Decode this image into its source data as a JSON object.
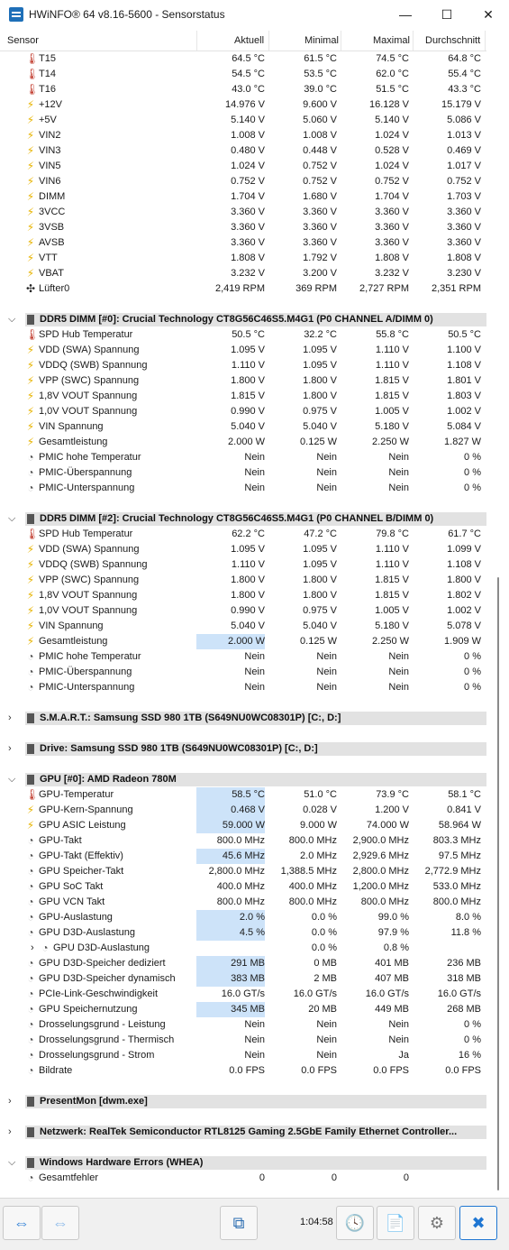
{
  "window": {
    "title": "HWiNFO® 64 v8.16-5600 - Sensorstatus",
    "min": "—",
    "max": "☐",
    "close": "✕"
  },
  "columns": {
    "sensor": "Sensor",
    "current": "Aktuell",
    "min": "Minimal",
    "max": "Maximal",
    "avg": "Durchschnitt"
  },
  "sections": [
    {
      "type": "rows",
      "rows": [
        {
          "icon": "thermometer",
          "label": "T15",
          "v": [
            "64.5 °C",
            "61.5 °C",
            "74.5 °C",
            "64.8 °C"
          ]
        },
        {
          "icon": "thermometer",
          "label": "T14",
          "v": [
            "54.5 °C",
            "53.5 °C",
            "62.0 °C",
            "55.4 °C"
          ]
        },
        {
          "icon": "thermometer",
          "label": "T16",
          "v": [
            "43.0 °C",
            "39.0 °C",
            "51.5 °C",
            "43.3 °C"
          ]
        },
        {
          "icon": "voltage",
          "label": "+12V",
          "v": [
            "14.976 V",
            "9.600 V",
            "16.128 V",
            "15.179 V"
          ]
        },
        {
          "icon": "voltage",
          "label": "+5V",
          "v": [
            "5.140 V",
            "5.060 V",
            "5.140 V",
            "5.086 V"
          ]
        },
        {
          "icon": "voltage",
          "label": "VIN2",
          "v": [
            "1.008 V",
            "1.008 V",
            "1.024 V",
            "1.013 V"
          ]
        },
        {
          "icon": "voltage",
          "label": "VIN3",
          "v": [
            "0.480 V",
            "0.448 V",
            "0.528 V",
            "0.469 V"
          ]
        },
        {
          "icon": "voltage",
          "label": "VIN5",
          "v": [
            "1.024 V",
            "0.752 V",
            "1.024 V",
            "1.017 V"
          ]
        },
        {
          "icon": "voltage",
          "label": "VIN6",
          "v": [
            "0.752 V",
            "0.752 V",
            "0.752 V",
            "0.752 V"
          ]
        },
        {
          "icon": "voltage",
          "label": "DIMM",
          "v": [
            "1.704 V",
            "1.680 V",
            "1.704 V",
            "1.703 V"
          ]
        },
        {
          "icon": "voltage",
          "label": "3VCC",
          "v": [
            "3.360 V",
            "3.360 V",
            "3.360 V",
            "3.360 V"
          ]
        },
        {
          "icon": "voltage",
          "label": "3VSB",
          "v": [
            "3.360 V",
            "3.360 V",
            "3.360 V",
            "3.360 V"
          ]
        },
        {
          "icon": "voltage",
          "label": "AVSB",
          "v": [
            "3.360 V",
            "3.360 V",
            "3.360 V",
            "3.360 V"
          ]
        },
        {
          "icon": "voltage",
          "label": "VTT",
          "v": [
            "1.808 V",
            "1.792 V",
            "1.808 V",
            "1.808 V"
          ]
        },
        {
          "icon": "voltage",
          "label": "VBAT",
          "v": [
            "3.232 V",
            "3.200 V",
            "3.232 V",
            "3.230 V"
          ]
        },
        {
          "icon": "fan",
          "label": "Lüfter0",
          "v": [
            "2,419 RPM",
            "369 RPM",
            "2,727 RPM",
            "2,351 RPM"
          ]
        }
      ]
    },
    {
      "type": "group",
      "expanded": true,
      "label": "DDR5 DIMM [#0]: Crucial Technology CT8G56C46S5.M4G1 (P0 CHANNEL A/DIMM 0)",
      "rows": [
        {
          "icon": "thermometer",
          "label": "SPD Hub Temperatur",
          "v": [
            "50.5 °C",
            "32.2 °C",
            "55.8 °C",
            "50.5 °C"
          ]
        },
        {
          "icon": "voltage",
          "label": "VDD (SWA) Spannung",
          "v": [
            "1.095 V",
            "1.095 V",
            "1.110 V",
            "1.100 V"
          ]
        },
        {
          "icon": "voltage",
          "label": "VDDQ (SWB) Spannung",
          "v": [
            "1.110 V",
            "1.095 V",
            "1.110 V",
            "1.108 V"
          ]
        },
        {
          "icon": "voltage",
          "label": "VPP (SWC) Spannung",
          "v": [
            "1.800 V",
            "1.800 V",
            "1.815 V",
            "1.801 V"
          ]
        },
        {
          "icon": "voltage",
          "label": "1,8V VOUT Spannung",
          "v": [
            "1.815 V",
            "1.800 V",
            "1.815 V",
            "1.803 V"
          ]
        },
        {
          "icon": "voltage",
          "label": "1,0V VOUT Spannung",
          "v": [
            "0.990 V",
            "0.975 V",
            "1.005 V",
            "1.002 V"
          ]
        },
        {
          "icon": "voltage",
          "label": "VIN Spannung",
          "v": [
            "5.040 V",
            "5.040 V",
            "5.180 V",
            "5.084 V"
          ]
        },
        {
          "icon": "voltage",
          "label": "Gesamtleistung",
          "v": [
            "2.000 W",
            "0.125 W",
            "2.250 W",
            "1.827 W"
          ]
        },
        {
          "icon": "clock",
          "label": "PMIC hohe Temperatur",
          "v": [
            "Nein",
            "Nein",
            "Nein",
            "0 %"
          ]
        },
        {
          "icon": "clock",
          "label": "PMIC-Überspannung",
          "v": [
            "Nein",
            "Nein",
            "Nein",
            "0 %"
          ]
        },
        {
          "icon": "clock",
          "label": "PMIC-Unterspannung",
          "v": [
            "Nein",
            "Nein",
            "Nein",
            "0 %"
          ]
        }
      ]
    },
    {
      "type": "group",
      "expanded": true,
      "label": "DDR5 DIMM [#2]: Crucial Technology CT8G56C46S5.M4G1 (P0 CHANNEL B/DIMM 0)",
      "rows": [
        {
          "icon": "thermometer",
          "label": "SPD Hub Temperatur",
          "v": [
            "62.2 °C",
            "47.2 °C",
            "79.8 °C",
            "61.7 °C"
          ]
        },
        {
          "icon": "voltage",
          "label": "VDD (SWA) Spannung",
          "v": [
            "1.095 V",
            "1.095 V",
            "1.110 V",
            "1.099 V"
          ]
        },
        {
          "icon": "voltage",
          "label": "VDDQ (SWB) Spannung",
          "v": [
            "1.110 V",
            "1.095 V",
            "1.110 V",
            "1.108 V"
          ]
        },
        {
          "icon": "voltage",
          "label": "VPP (SWC) Spannung",
          "v": [
            "1.800 V",
            "1.800 V",
            "1.815 V",
            "1.800 V"
          ]
        },
        {
          "icon": "voltage",
          "label": "1,8V VOUT Spannung",
          "v": [
            "1.800 V",
            "1.800 V",
            "1.815 V",
            "1.802 V"
          ]
        },
        {
          "icon": "voltage",
          "label": "1,0V VOUT Spannung",
          "v": [
            "0.990 V",
            "0.975 V",
            "1.005 V",
            "1.002 V"
          ]
        },
        {
          "icon": "voltage",
          "label": "VIN Spannung",
          "v": [
            "5.040 V",
            "5.040 V",
            "5.180 V",
            "5.078 V"
          ]
        },
        {
          "icon": "voltage",
          "label": "Gesamtleistung",
          "v": [
            "2.000 W",
            "0.125 W",
            "2.250 W",
            "1.909 W"
          ],
          "hl": true
        },
        {
          "icon": "clock",
          "label": "PMIC hohe Temperatur",
          "v": [
            "Nein",
            "Nein",
            "Nein",
            "0 %"
          ]
        },
        {
          "icon": "clock",
          "label": "PMIC-Überspannung",
          "v": [
            "Nein",
            "Nein",
            "Nein",
            "0 %"
          ]
        },
        {
          "icon": "clock",
          "label": "PMIC-Unterspannung",
          "v": [
            "Nein",
            "Nein",
            "Nein",
            "0 %"
          ]
        }
      ]
    },
    {
      "type": "group",
      "expanded": false,
      "label": "S.M.A.R.T.: Samsung SSD 980 1TB (S649NU0WC08301P) [C:, D:]",
      "rows": []
    },
    {
      "type": "group",
      "expanded": false,
      "label": "Drive: Samsung SSD 980 1TB (S649NU0WC08301P) [C:, D:]",
      "rows": []
    },
    {
      "type": "group",
      "expanded": true,
      "label": "GPU [#0]: AMD Radeon 780M",
      "rows": [
        {
          "icon": "thermometer",
          "label": "GPU-Temperatur",
          "v": [
            "58.5 °C",
            "51.0 °C",
            "73.9 °C",
            "58.1 °C"
          ],
          "hl": true
        },
        {
          "icon": "voltage",
          "label": "GPU-Kern-Spannung",
          "v": [
            "0.468 V",
            "0.028 V",
            "1.200 V",
            "0.841 V"
          ],
          "hl": true
        },
        {
          "icon": "voltage",
          "label": "GPU ASIC Leistung",
          "v": [
            "59.000 W",
            "9.000 W",
            "74.000 W",
            "58.964 W"
          ],
          "hl": true
        },
        {
          "icon": "clock",
          "label": "GPU-Takt",
          "v": [
            "800.0 MHz",
            "800.0 MHz",
            "2,900.0 MHz",
            "803.3 MHz"
          ]
        },
        {
          "icon": "clock",
          "label": "GPU-Takt (Effektiv)",
          "v": [
            "45.6 MHz",
            "2.0 MHz",
            "2,929.6 MHz",
            "97.5 MHz"
          ],
          "hl": true
        },
        {
          "icon": "clock",
          "label": "GPU Speicher-Takt",
          "v": [
            "2,800.0 MHz",
            "1,388.5 MHz",
            "2,800.0 MHz",
            "2,772.9 MHz"
          ]
        },
        {
          "icon": "clock",
          "label": "GPU SoC Takt",
          "v": [
            "400.0 MHz",
            "400.0 MHz",
            "1,200.0 MHz",
            "533.0 MHz"
          ]
        },
        {
          "icon": "clock",
          "label": "GPU VCN Takt",
          "v": [
            "800.0 MHz",
            "800.0 MHz",
            "800.0 MHz",
            "800.0 MHz"
          ]
        },
        {
          "icon": "clock",
          "label": "GPU-Auslastung",
          "v": [
            "2.0 %",
            "0.0 %",
            "99.0 %",
            "8.0 %"
          ],
          "hl": true
        },
        {
          "icon": "clock",
          "label": "GPU D3D-Auslastung",
          "v": [
            "4.5 %",
            "0.0 %",
            "97.9 %",
            "11.8 %"
          ],
          "hl": true
        },
        {
          "icon": "clock",
          "label": "GPU D3D-Auslastung",
          "v": [
            "",
            "0.0 %",
            "0.8 %",
            ""
          ],
          "sub": true
        },
        {
          "icon": "clock",
          "label": "GPU D3D-Speicher dediziert",
          "v": [
            "291 MB",
            "0 MB",
            "401 MB",
            "236 MB"
          ],
          "hl": true
        },
        {
          "icon": "clock",
          "label": "GPU D3D-Speicher dynamisch",
          "v": [
            "383 MB",
            "2 MB",
            "407 MB",
            "318 MB"
          ],
          "hl": true
        },
        {
          "icon": "clock",
          "label": "PCIe-Link-Geschwindigkeit",
          "v": [
            "16.0 GT/s",
            "16.0 GT/s",
            "16.0 GT/s",
            "16.0 GT/s"
          ]
        },
        {
          "icon": "clock",
          "label": "GPU Speichernutzung",
          "v": [
            "345 MB",
            "20 MB",
            "449 MB",
            "268 MB"
          ],
          "hl": true
        },
        {
          "icon": "clock",
          "label": "Drosselungsgrund - Leistung",
          "v": [
            "Nein",
            "Nein",
            "Nein",
            "0 %"
          ]
        },
        {
          "icon": "clock",
          "label": "Drosselungsgrund - Thermisch",
          "v": [
            "Nein",
            "Nein",
            "Nein",
            "0 %"
          ]
        },
        {
          "icon": "clock",
          "label": "Drosselungsgrund - Strom",
          "v": [
            "Nein",
            "Nein",
            "Ja",
            "16 %"
          ]
        },
        {
          "icon": "clock",
          "label": "Bildrate",
          "v": [
            "0.0 FPS",
            "0.0 FPS",
            "0.0 FPS",
            "0.0 FPS"
          ]
        }
      ]
    },
    {
      "type": "group",
      "expanded": false,
      "label": "PresentMon [dwm.exe]",
      "rows": []
    },
    {
      "type": "group",
      "expanded": false,
      "label": "Netzwerk: RealTek Semiconductor RTL8125 Gaming 2.5GbE Family Ethernet Controller...",
      "rows": []
    },
    {
      "type": "group",
      "expanded": true,
      "label": "Windows Hardware Errors (WHEA)",
      "rows": [
        {
          "icon": "clock",
          "label": "Gesamtfehler",
          "v": [
            "0",
            "0",
            "0",
            ""
          ]
        }
      ]
    }
  ],
  "footer": {
    "elapsed": "1:04:58"
  },
  "icons": {
    "thermometer": "🌡",
    "voltage": "⚡",
    "clock": "◔",
    "fan": "✣"
  },
  "colors": {
    "highlight": "#cde3f9",
    "group_bar": "#e2e2e2",
    "accent": "#1e6fb8"
  }
}
